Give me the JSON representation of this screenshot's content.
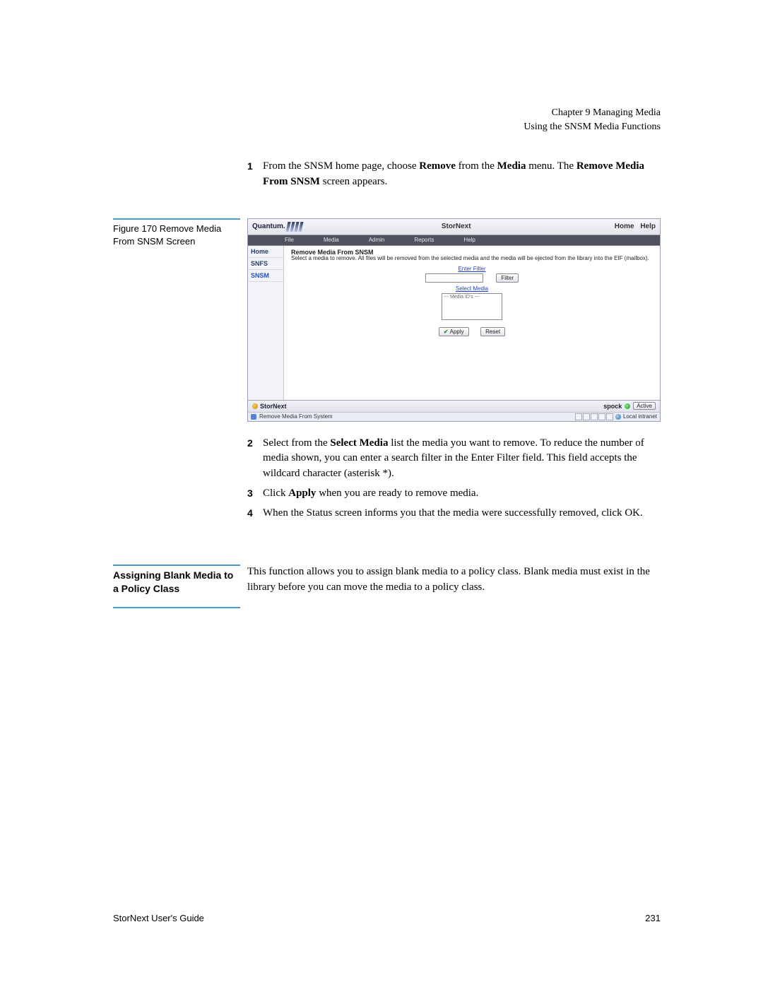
{
  "header": {
    "chapter": "Chapter 9  Managing Media",
    "section": "Using the SNSM Media Functions"
  },
  "step1": {
    "num": "1",
    "pre": "From the SNSM home page, choose ",
    "bold1": "Remove",
    "mid": " from the ",
    "bold2": "Media",
    "post": " menu. The ",
    "bold3": "Remove Media From SNSM",
    "end": " screen appears."
  },
  "figure": {
    "caption": "Figure 170  Remove Media From SNSM Screen"
  },
  "screenshot": {
    "brand": "Quantum.",
    "title": "StorNext",
    "links": {
      "home": "Home",
      "help": "Help"
    },
    "menu": {
      "file": "File",
      "media": "Media",
      "admin": "Admin",
      "reports": "Reports",
      "help": "Help"
    },
    "sidebar": {
      "home": "Home",
      "snfs": "SNFS",
      "snsm": "SNSM"
    },
    "panel": {
      "title": "Remove Media From SNSM",
      "desc": "Select a media to remove. All files will be removed from the selected media and the media will be ejected from the library into the EIF (mailbox).",
      "enter_filter": "Enter Filter",
      "filter_btn": "Filter",
      "select_media": "Select Media",
      "media_ids": "--- Media ID's ---",
      "apply": "Apply",
      "reset": "Reset"
    },
    "footer": {
      "logo": "StorNext",
      "host": "spock",
      "status": "Active"
    },
    "iebar": {
      "left": "Remove Media From System",
      "right": "Local intranet"
    }
  },
  "steps_after": {
    "s2": {
      "num": "2",
      "pre": "Select from the ",
      "bold": "Select Media",
      "post": " list the media you want to remove. To reduce the number of media shown, you can enter a search filter in the Enter Filter field. This field accepts the wildcard character (asterisk *)."
    },
    "s3": {
      "num": "3",
      "pre": "Click ",
      "bold": "Apply",
      "post": " when you are ready to remove media."
    },
    "s4": {
      "num": "4",
      "text": "When the Status screen informs you that the media were successfully removed, click OK."
    }
  },
  "section2": {
    "heading": "Assigning Blank Media to a Policy Class",
    "body": "This function allows you to assign blank media to a policy class. Blank media must exist in the library before you can move the media to a policy class."
  },
  "footer": {
    "left": "StorNext User's Guide",
    "right": "231"
  }
}
